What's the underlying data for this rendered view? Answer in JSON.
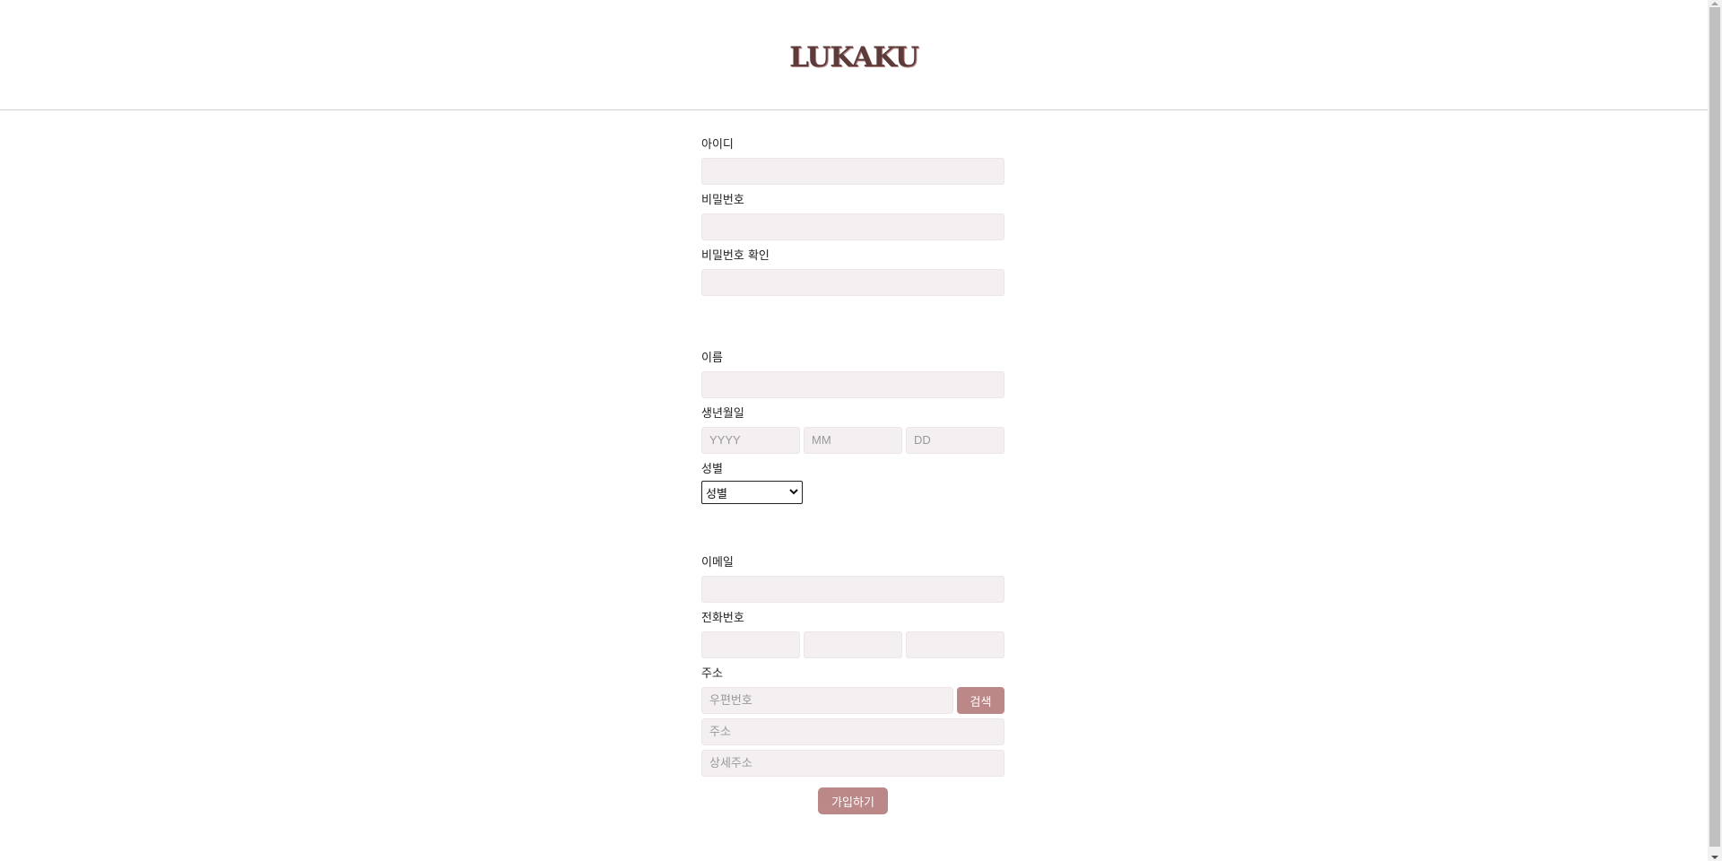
{
  "header": {
    "logo": "LUKAKU"
  },
  "form": {
    "id_label": "아이디",
    "password_label": "비밀번호",
    "password_confirm_label": "비밀번호 확인",
    "name_label": "이름",
    "birth_label": "생년월일",
    "birth_year_placeholder": "YYYY",
    "birth_month_placeholder": "MM",
    "birth_day_placeholder": "DD",
    "gender_label": "성별",
    "gender_selected": "성별",
    "email_label": "이메일",
    "phone_label": "전화번호",
    "address_label": "주소",
    "zip_placeholder": "우편번호",
    "search_button": "검색",
    "address_placeholder": "주소",
    "detail_address_placeholder": "상세주소",
    "submit_button": "가입하기"
  },
  "colors": {
    "accent": "#bc8787",
    "field_bg": "#f4eff0",
    "logo": "#5e3b3b"
  },
  "icons": {
    "select": "chevron-down-icon"
  }
}
